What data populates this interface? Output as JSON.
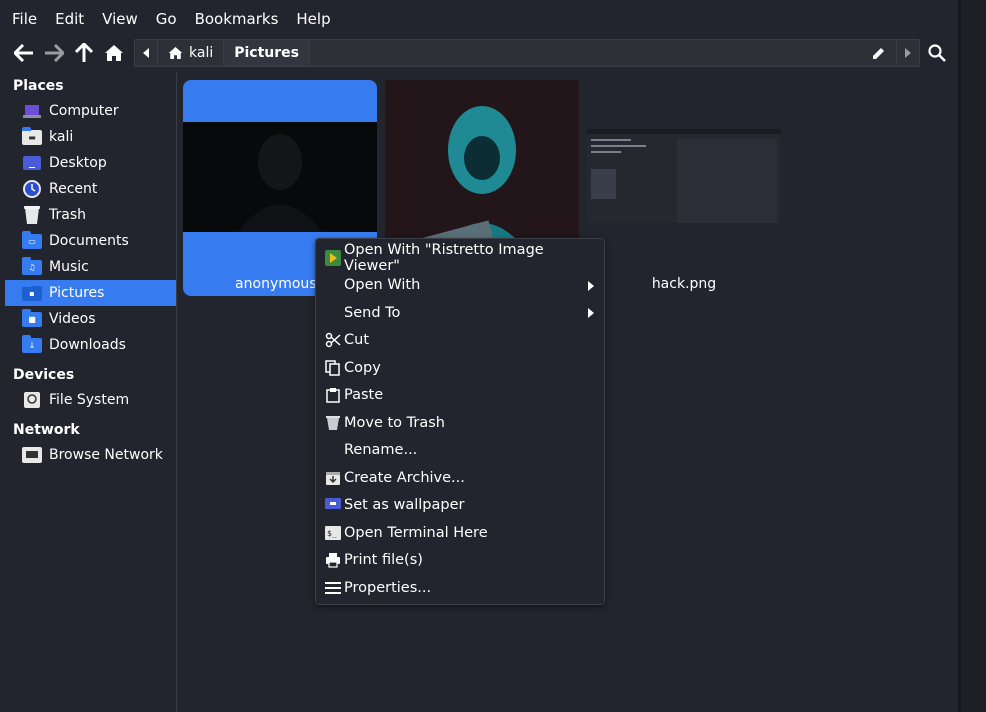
{
  "menubar": {
    "items": [
      "File",
      "Edit",
      "View",
      "Go",
      "Bookmarks",
      "Help"
    ]
  },
  "pathbar": {
    "crumbs": [
      "kali",
      "Pictures"
    ]
  },
  "sidebar": {
    "places_title": "Places",
    "places": [
      "Computer",
      "kali",
      "Desktop",
      "Recent",
      "Trash",
      "Documents",
      "Music",
      "Pictures",
      "Videos",
      "Downloads"
    ],
    "devices_title": "Devices",
    "devices": [
      "File System"
    ],
    "network_title": "Network",
    "network": [
      "Browse Network"
    ]
  },
  "files": [
    {
      "name": "anonymous.jpg",
      "visible_label": "anonymous.j"
    },
    {
      "name": "",
      "visible_label": ""
    },
    {
      "name": "hack.png",
      "visible_label": "hack.png"
    }
  ],
  "context_menu": {
    "items": [
      "Open With \"Ristretto Image Viewer\"",
      "Open With",
      "Send To",
      "Cut",
      "Copy",
      "Paste",
      "Move to Trash",
      "Rename...",
      "Create Archive...",
      "Set as wallpaper",
      "Open Terminal Here",
      "Print file(s)",
      "Properties..."
    ]
  },
  "colors": {
    "accent": "#367bf0",
    "background": "#23252e",
    "panel": "#2e3038"
  }
}
